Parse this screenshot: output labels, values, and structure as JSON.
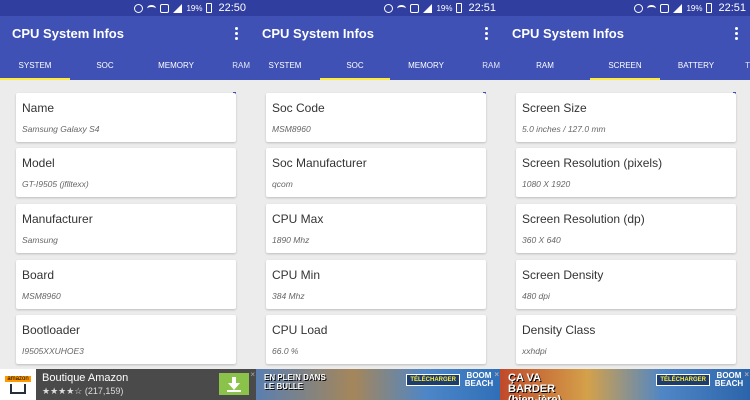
{
  "status_bar": {
    "battery_pct": "19%",
    "times": [
      "22:50",
      "22:51",
      "22:51"
    ]
  },
  "app": {
    "title": "CPU System Infos"
  },
  "screens": [
    {
      "tabs": [
        {
          "label": "SYSTEM",
          "active": true
        },
        {
          "label": "SOC",
          "active": false
        },
        {
          "label": "MEMORY",
          "active": false
        },
        {
          "label": "RAM",
          "active": false
        }
      ],
      "cards": [
        {
          "label": "Name",
          "value": "Samsung Galaxy S4"
        },
        {
          "label": "Model",
          "value": "GT-I9505 (jflltexx)"
        },
        {
          "label": "Manufacturer",
          "value": "Samsung"
        },
        {
          "label": "Board",
          "value": "MSM8960"
        },
        {
          "label": "Bootloader",
          "value": "I9505XXUHOE3"
        }
      ]
    },
    {
      "tabs": [
        {
          "label": "SYSTEM",
          "active": false
        },
        {
          "label": "SOC",
          "active": true
        },
        {
          "label": "MEMORY",
          "active": false
        },
        {
          "label": "RAM",
          "active": false
        }
      ],
      "cards": [
        {
          "label": "Soc Code",
          "value": "MSM8960"
        },
        {
          "label": "Soc Manufacturer",
          "value": "qcom"
        },
        {
          "label": "CPU Max",
          "value": "1890 Mhz"
        },
        {
          "label": "CPU Min",
          "value": "384 Mhz"
        },
        {
          "label": "CPU Load",
          "value": "66.0 %"
        }
      ]
    },
    {
      "tabs": [
        {
          "label": "RAM",
          "active": false
        },
        {
          "label": "SCREEN",
          "active": true
        },
        {
          "label": "BATTERY",
          "active": false
        },
        {
          "label": "T",
          "active": false
        }
      ],
      "cards": [
        {
          "label": "Screen Size",
          "value": "5.0 inches / 127.0 mm"
        },
        {
          "label": "Screen Resolution (pixels)",
          "value": "1080 X 1920"
        },
        {
          "label": "Screen Resolution (dp)",
          "value": "360 X 640"
        },
        {
          "label": "Screen Density",
          "value": "480 dpi"
        },
        {
          "label": "Density Class",
          "value": "xxhdpi"
        }
      ]
    }
  ],
  "ads": {
    "amazon": {
      "logo_text": "amazon",
      "title": "Boutique Amazon",
      "stars": "★★★★☆",
      "count": "(217,159)"
    },
    "banner1": {
      "text": "EN PLEIN DANS LE BULLE",
      "badge": "TÉLÉCHARGER",
      "logo": "BOOM BEACH"
    },
    "banner2": {
      "text": "ÇA VA BARDER (bien-ière)",
      "badge": "TÉLÉCHARGER",
      "logo": "BOOM BEACH"
    },
    "close_glyph": "×"
  },
  "colors": {
    "primary": "#3f51b5",
    "primary_dark": "#303f9f",
    "tab_indicator": "#ffeb3b"
  }
}
